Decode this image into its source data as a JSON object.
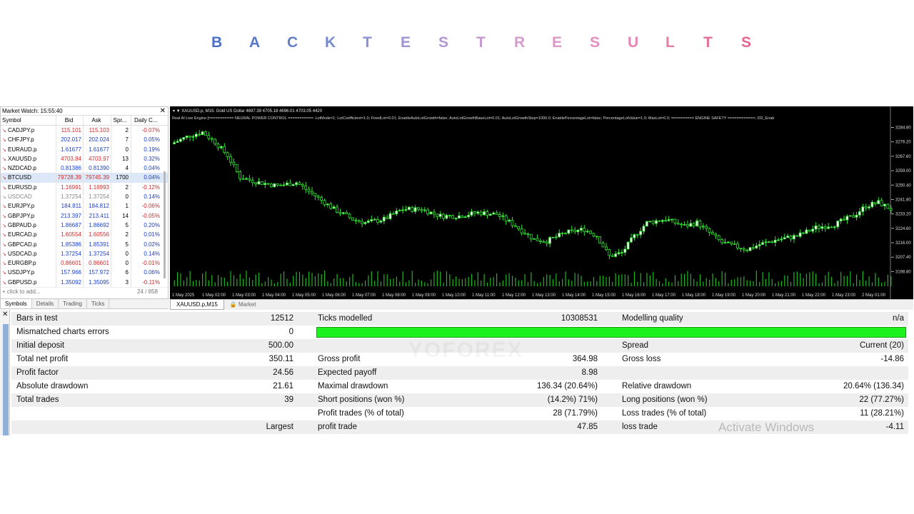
{
  "title": {
    "letters": [
      {
        "ch": "B",
        "color": "#4a6fc8"
      },
      {
        "ch": "A",
        "color": "#5577cb"
      },
      {
        "ch": "C",
        "color": "#6480cd"
      },
      {
        "ch": "K",
        "color": "#7588d0"
      },
      {
        "ch": "T",
        "color": "#8a8fd2"
      },
      {
        "ch": "E",
        "color": "#9f92d3"
      },
      {
        "ch": "S",
        "color": "#b596d4"
      },
      {
        "ch": "T",
        "color": "#c599d2"
      },
      {
        "ch": "R",
        "color": "#d49bcf"
      },
      {
        "ch": "E",
        "color": "#de98c8"
      },
      {
        "ch": "S",
        "color": "#e48fbe"
      },
      {
        "ch": "U",
        "color": "#e685b2"
      },
      {
        "ch": "L",
        "color": "#e77ba6"
      },
      {
        "ch": "T",
        "color": "#e7709a"
      },
      {
        "ch": "S",
        "color": "#e6648c"
      }
    ]
  },
  "market_watch": {
    "title": "Market Watch: 15:55:40",
    "columns": [
      "Symbol",
      "Bid",
      "Ask",
      "Spr...",
      "Daily C..."
    ],
    "rows": [
      {
        "symbol": "CADJPY.p",
        "bid": "115.101",
        "ask": "115.103",
        "spread": "2",
        "change": "-0.07%",
        "dir": "dn"
      },
      {
        "symbol": "CHFJPY.p",
        "bid": "202.017",
        "ask": "202.024",
        "spread": "7",
        "change": "0.05%",
        "dir": "up"
      },
      {
        "symbol": "EURAUD.p",
        "bid": "1.61677",
        "ask": "1.61677",
        "spread": "0",
        "change": "0.19%",
        "dir": "up"
      },
      {
        "symbol": "XAUUSD.p",
        "bid": "4703.84",
        "ask": "4703.97",
        "spread": "13",
        "change": "0.32%",
        "dir": "dn"
      },
      {
        "symbol": "NZDCAD.p",
        "bid": "0.81386",
        "ask": "0.81390",
        "spread": "4",
        "change": "0.04%",
        "dir": "up"
      },
      {
        "symbol": "BTCUSD",
        "bid": "79728.39",
        "ask": "79745.39",
        "spread": "1700",
        "change": "0.04%",
        "dir": "dn",
        "selected": true
      },
      {
        "symbol": "EURUSD.p",
        "bid": "1.16991",
        "ask": "1.16993",
        "spread": "2",
        "change": "-0.12%",
        "dir": "dn"
      },
      {
        "symbol": "USDCAD",
        "bid": "1.37254",
        "ask": "1.37254",
        "spread": "0",
        "change": "0.14%",
        "dir": "gray"
      },
      {
        "symbol": "EURJPY.p",
        "bid": "184.811",
        "ask": "184.812",
        "spread": "1",
        "change": "-0.06%",
        "dir": "up"
      },
      {
        "symbol": "GBPJPY.p",
        "bid": "213.397",
        "ask": "213.411",
        "spread": "14",
        "change": "-0.05%",
        "dir": "up"
      },
      {
        "symbol": "GBPAUD.p",
        "bid": "1.86687",
        "ask": "1.86692",
        "spread": "5",
        "change": "0.20%",
        "dir": "up"
      },
      {
        "symbol": "EURCAD.p",
        "bid": "1.60554",
        "ask": "1.60556",
        "spread": "2",
        "change": "0.01%",
        "dir": "dn"
      },
      {
        "symbol": "GBPCAD.p",
        "bid": "1.85386",
        "ask": "1.85391",
        "spread": "5",
        "change": "0.02%",
        "dir": "up"
      },
      {
        "symbol": "USDCAD.p",
        "bid": "1.37254",
        "ask": "1.37254",
        "spread": "0",
        "change": "0.14%",
        "dir": "up"
      },
      {
        "symbol": "EURGBP.p",
        "bid": "0.86601",
        "ask": "0.86601",
        "spread": "0",
        "change": "-0.01%",
        "dir": "dn"
      },
      {
        "symbol": "USDJPY.p",
        "bid": "157.966",
        "ask": "157.972",
        "spread": "6",
        "change": "0.06%",
        "dir": "up"
      },
      {
        "symbol": "GBPUSD.p",
        "bid": "1.35092",
        "ask": "1.35095",
        "spread": "3",
        "change": "-0.11%",
        "dir": "up"
      }
    ],
    "add_text": "click to add...",
    "count": "24 / 858",
    "tabs": [
      "Symbols",
      "Details",
      "Trading",
      "Ticks"
    ]
  },
  "chart": {
    "header": "XAUUSD.p, M15:  Gold US Dollar  4697.39 4705.18 4696.01 4703.05  4420",
    "line2": "Real AI Live Engine [=========== NEURAL POWER CONTROL ===========: LotMode=1; LotCoefficient=1.0; FixedLot=0.01; EnableAutoLotGrowth=false; AutoLotGrowthBaseLot=0.01; AutoLotGrowthStep=1000.0; EnablePercentageLot=false; PercentageLotValue=1.0; MaxLot=0.0; ========== ENGINE SAFETY ============; DD_Enab",
    "y_ticks": [
      "3284.80",
      "3276.20",
      "3267.60",
      "3259.00",
      "3250.40",
      "3241.80",
      "3233.20",
      "3224.60",
      "3216.00",
      "3207.40",
      "3198.80"
    ],
    "x_ticks": [
      "1 May 2025",
      "1 May 02:00",
      "1 May 03:00",
      "1 May 04:00",
      "1 May 05:00",
      "1 May 06:00",
      "1 May 07:00",
      "1 May 08:00",
      "1 May 09:00",
      "1 May 10:00",
      "1 May 11:00",
      "1 May 12:00",
      "1 May 13:00",
      "1 May 14:00",
      "1 May 15:00",
      "1 May 16:00",
      "1 May 17:00",
      "1 May 18:00",
      "1 May 19:00",
      "1 May 20:00",
      "1 May 21:00",
      "1 May 22:00",
      "1 May 23:00",
      "2 May 01:00"
    ],
    "bull_color": "#ffffff",
    "bear_color": "#000000",
    "wick_color": "#2ee62e",
    "volume_color": "#1fb81f",
    "tabs": [
      "XAUUSD.p,M15",
      "Market"
    ]
  },
  "report": {
    "rows": [
      {
        "alt": true,
        "cells": [
          {
            "x": 23,
            "text": "Bars in test"
          },
          {
            "x": 411,
            "text": "12512",
            "right": true
          },
          {
            "x": 445,
            "text": "Ticks modelled"
          },
          {
            "x": 837,
            "text": "10308531",
            "right": true
          },
          {
            "x": 871,
            "text": "Modelling quality"
          },
          {
            "x": 1266,
            "text": "n/a",
            "right": true
          }
        ]
      },
      {
        "alt": false,
        "cells": [
          {
            "x": 23,
            "text": "Mismatched charts errors"
          },
          {
            "x": 411,
            "text": "0",
            "right": true
          }
        ]
      },
      {
        "alt": true,
        "cells": [
          {
            "x": 23,
            "text": "Initial deposit"
          },
          {
            "x": 411,
            "text": "500.00",
            "right": true
          },
          {
            "x": 871,
            "text": "Spread"
          },
          {
            "x": 1266,
            "text": "Current (20)",
            "right": true
          }
        ]
      },
      {
        "alt": false,
        "cells": [
          {
            "x": 23,
            "text": "Total net profit"
          },
          {
            "x": 411,
            "text": "350.11",
            "right": true
          },
          {
            "x": 445,
            "text": "Gross profit"
          },
          {
            "x": 837,
            "text": "364.98",
            "right": true
          },
          {
            "x": 871,
            "text": "Gross loss"
          },
          {
            "x": 1266,
            "text": "-14.86",
            "right": true
          }
        ]
      },
      {
        "alt": true,
        "cells": [
          {
            "x": 23,
            "text": "Profit factor"
          },
          {
            "x": 411,
            "text": "24.56",
            "right": true
          },
          {
            "x": 445,
            "text": "Expected payoff"
          },
          {
            "x": 837,
            "text": "8.98",
            "right": true
          }
        ]
      },
      {
        "alt": false,
        "cells": [
          {
            "x": 23,
            "text": "Absolute drawdown"
          },
          {
            "x": 411,
            "text": "21.61",
            "right": true
          },
          {
            "x": 445,
            "text": "Maximal drawdown"
          },
          {
            "x": 837,
            "text": "136.34 (20.64%)",
            "right": true
          },
          {
            "x": 871,
            "text": "Relative drawdown"
          },
          {
            "x": 1266,
            "text": "20.64% (136.34)",
            "right": true
          }
        ]
      },
      {
        "alt": true,
        "cells": [
          {
            "x": 23,
            "text": "Total trades"
          },
          {
            "x": 411,
            "text": "39",
            "right": true
          },
          {
            "x": 445,
            "text": "Short positions (won %)"
          },
          {
            "x": 837,
            "text": "(14.2%) 71%)",
            "right": true
          },
          {
            "x": 871,
            "text": "Long positions (won %)"
          },
          {
            "x": 1266,
            "text": "22 (77.27%)",
            "right": true
          }
        ]
      },
      {
        "alt": false,
        "cells": [
          {
            "x": 445,
            "text": "Profit trades (% of total)"
          },
          {
            "x": 837,
            "text": "28 (71.79%)",
            "right": true
          },
          {
            "x": 871,
            "text": "Loss trades (% of total)"
          },
          {
            "x": 1266,
            "text": "11 (28.21%)",
            "right": true
          }
        ]
      },
      {
        "alt": true,
        "cells": [
          {
            "x": 411,
            "text": "Largest",
            "right": true
          },
          {
            "x": 445,
            "text": "profit trade"
          },
          {
            "x": 837,
            "text": "47.85",
            "right": true
          },
          {
            "x": 871,
            "text": "loss trade"
          },
          {
            "x": 1266,
            "text": "-4.11",
            "right": true
          }
        ]
      }
    ],
    "modelling_quality_color": "#1ef21e",
    "brand": "YOFOREX",
    "watermark": "Activate Windows"
  }
}
